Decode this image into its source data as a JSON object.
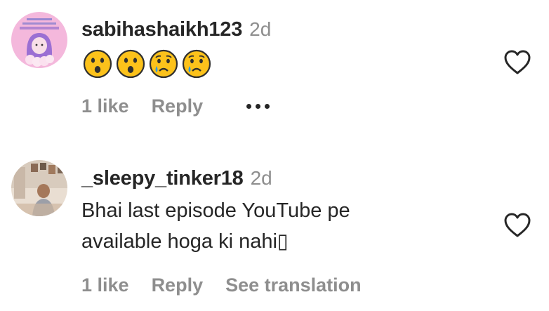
{
  "comments": [
    {
      "username": "sabihashaikh123",
      "time": "2d",
      "emojis": [
        "hushed-face-emoji",
        "hushed-face-emoji",
        "crying-face-emoji",
        "crying-face-emoji"
      ],
      "likes_label": "1 like",
      "reply_label": "Reply"
    },
    {
      "username": "_sleepy_tinker18",
      "time": "2d",
      "text_line1": "Bhai last episode YouTube pe",
      "text_line2": "available hoga ki nahi▯",
      "likes_label": "1 like",
      "reply_label": "Reply",
      "translate_label": "See translation"
    }
  ],
  "colors": {
    "primary_text": "#262626",
    "secondary_text": "#8e8e8e",
    "avatar1_bg": "#f4b8dc",
    "emoji_yellow": "#fcc21b"
  }
}
